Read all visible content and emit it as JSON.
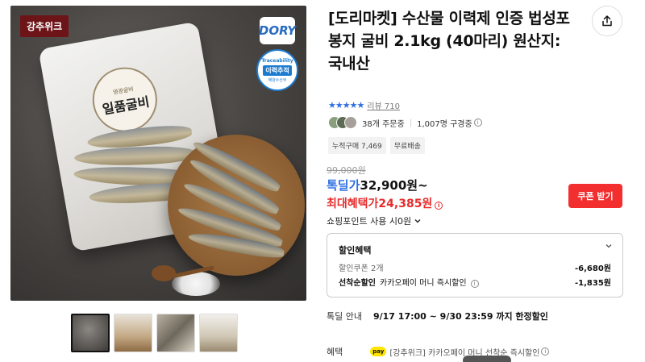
{
  "media": {
    "badge": "강추위크",
    "brand_logo": "DORY",
    "seal_top": "Traceability",
    "seal_mid": "이력추적",
    "seal_bottom": "해양수산부",
    "bag_title": "일품굴비",
    "bag_subtitle": "영광굴비",
    "thumbnails": [
      "thumb-1",
      "thumb-2",
      "thumb-3",
      "thumb-4"
    ]
  },
  "product": {
    "title": "[도리마켓] 수산물 이력제 인증 법성포 봉지 굴비 2.1kg (40마리) 원산지: 국내산",
    "share_icon": "share-icon",
    "rating_stars": "★★★★★",
    "review_text": "리뷰 710",
    "orders_text": "38개 주문중",
    "watching_text": "1,007명 구경중",
    "tags": [
      "누적구매 7,469",
      "무료배송"
    ],
    "original_price": "99,000원",
    "deal_label": "톡딜가",
    "deal_price": "32,900원~",
    "max_label": "최대혜택가",
    "max_price": "24,385원",
    "coupon_button": "쿠폰 받기",
    "points_text": "쇼핑포인트 사용 시0원"
  },
  "benefit_box": {
    "title": "할인혜택",
    "row1_label": "할인쿠폰 2개",
    "row1_amount": "-6,680원",
    "row2_label_strong": "선착순할인",
    "row2_label": "카카오페이 머니 즉시할인",
    "row2_amount": "-1,835원"
  },
  "deal_guide": {
    "label": "톡딜 안내",
    "value": "9/17 17:00 ~ 9/30 23:59 까지 한정할인"
  },
  "benefit_bottom": {
    "label": "혜택",
    "badge": "pay",
    "text": "[강추위크] 카카오페이 머니 선착순 즉시할인"
  },
  "colors": {
    "accent_blue": "#2f6fe4",
    "accent_red": "#e62c2c",
    "button_red": "#f22e2e",
    "badge_maroon": "#6d1418"
  }
}
